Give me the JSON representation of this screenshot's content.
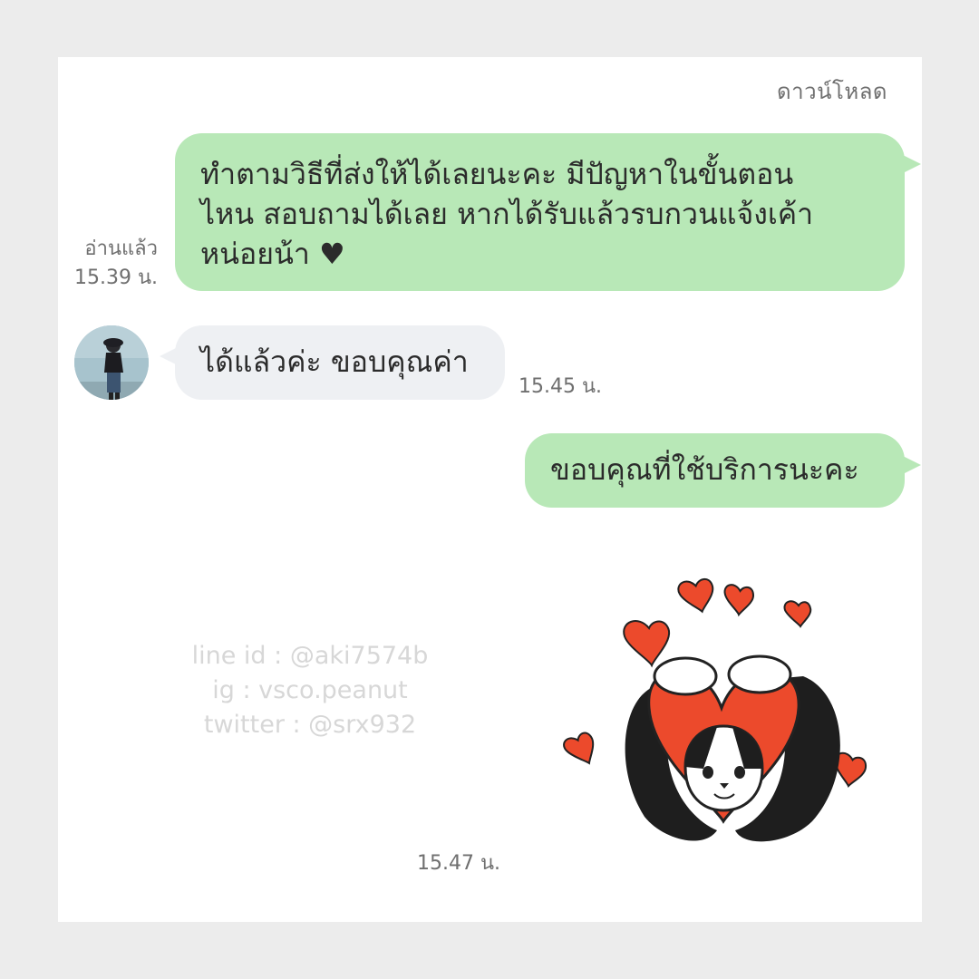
{
  "header": {
    "download_label": "ดาวน์โหลด"
  },
  "messages": [
    {
      "direction": "outgoing",
      "lines": [
        "ทำตามวิธีที่ส่งให้ได้เลยนะคะ มีปัญหาในขั้นตอน",
        "ไหน สอบถามได้เลย หากได้รับแล้วรบกวนแจ้งเค้า",
        "หน่อยน้า ♥"
      ],
      "read_label": "อ่านแล้ว",
      "time": "15.39 น."
    },
    {
      "direction": "incoming",
      "text": "ได้แล้วค่ะ ขอบคุณค่า",
      "time": "15.45 น."
    },
    {
      "direction": "outgoing",
      "text": "ขอบคุณที่ใช้บริการนะคะ"
    },
    {
      "direction": "outgoing",
      "type": "sticker",
      "sticker_name": "cat-hearts-sticker",
      "time": "15.47 น."
    }
  ],
  "watermark": {
    "line_id": "line id : @aki7574b",
    "ig": "ig : vsco.peanut",
    "twitter": "twitter : @srx932"
  },
  "colors": {
    "outgoing_bubble": "#b8e8b7",
    "incoming_bubble": "#eef0f3",
    "heart": "#ec4a2c"
  }
}
